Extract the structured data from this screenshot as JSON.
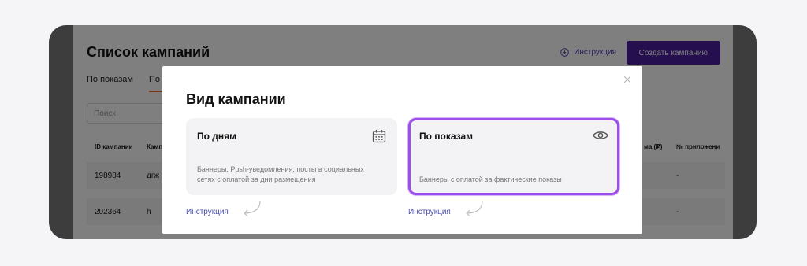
{
  "background_page": {
    "title": "Список кампаний",
    "instruction_link": "Инструкция",
    "create_button": "Создать кампанию",
    "tabs": [
      {
        "label": "По показам",
        "active": false
      },
      {
        "label": "По д",
        "active": true
      }
    ],
    "search_placeholder": "Поиск",
    "table": {
      "headers": [
        "ID кампании",
        "Камп",
        "ма (₽)",
        "№ приложени"
      ],
      "rows": [
        {
          "id": "198984",
          "name": "дгж",
          "amount": "",
          "app": "-"
        },
        {
          "id": "202364",
          "name": "h",
          "amount": "",
          "app": "-"
        }
      ]
    }
  },
  "modal": {
    "title": "Вид кампании",
    "options": [
      {
        "title": "По дням",
        "description": "Баннеры, Push-уведомления, посты в социальных сетях с оплатой за дни размещения",
        "icon": "calendar-icon",
        "selected": false,
        "instruction_link": "Инструкция"
      },
      {
        "title": "По показам",
        "description": "Баннеры с оплатой за фактические показы",
        "icon": "eye-icon",
        "selected": true,
        "instruction_link": "Инструкция"
      }
    ]
  },
  "colors": {
    "accent_purple": "#4a1f9c",
    "selection_border": "#9c4dea",
    "tab_underline": "#f06a2a",
    "link": "#4a4fb0"
  }
}
